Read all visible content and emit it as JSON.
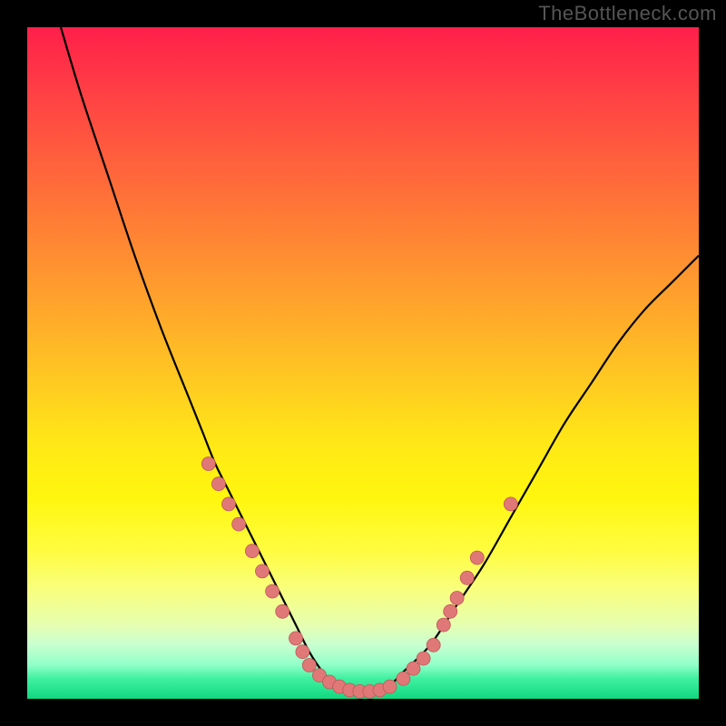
{
  "watermark": "TheBottleneck.com",
  "colors": {
    "frame": "#000000",
    "watermark": "#555555",
    "curve": "#000000",
    "marker_fill": "#e07878",
    "marker_stroke": "#c05858"
  },
  "chart_data": {
    "type": "line",
    "title": "",
    "xlabel": "",
    "ylabel": "",
    "xlim": [
      0,
      100
    ],
    "ylim": [
      0,
      100
    ],
    "grid": false,
    "note": "Axes are unlabeled in the source image; values are normalized 0–100 estimates read from the geometry. y increases upward (y=0 at bottom/green, y=100 at top/red).",
    "series": [
      {
        "name": "bottleneck-curve",
        "x": [
          5,
          8,
          12,
          16,
          20,
          24,
          26,
          28,
          30,
          32,
          34,
          36,
          38,
          40,
          42,
          44,
          46,
          48,
          50,
          52,
          54,
          56,
          60,
          64,
          68,
          72,
          76,
          80,
          84,
          88,
          92,
          96,
          100
        ],
        "y": [
          100,
          90,
          78,
          66,
          55,
          45,
          40,
          35,
          31,
          27,
          23,
          19,
          15,
          11,
          7,
          4,
          2,
          1,
          1,
          1,
          2,
          4,
          8,
          14,
          20,
          27,
          34,
          41,
          47,
          53,
          58,
          62,
          66
        ]
      }
    ],
    "markers": {
      "name": "highlighted-points",
      "note": "Salmon dots clustered on the lower limbs and trough of the curve.",
      "x": [
        27,
        28.5,
        30,
        31.5,
        33.5,
        35,
        36.5,
        38,
        40,
        41,
        42,
        43.5,
        45,
        46.5,
        48,
        49.5,
        51,
        52.5,
        54,
        56,
        57.5,
        59,
        60.5,
        62,
        63,
        64,
        65.5,
        67,
        72
      ],
      "y": [
        35,
        32,
        29,
        26,
        22,
        19,
        16,
        13,
        9,
        7,
        5,
        3.5,
        2.5,
        1.8,
        1.3,
        1.1,
        1.1,
        1.3,
        1.8,
        3,
        4.5,
        6,
        8,
        11,
        13,
        15,
        18,
        21,
        29
      ]
    }
  }
}
